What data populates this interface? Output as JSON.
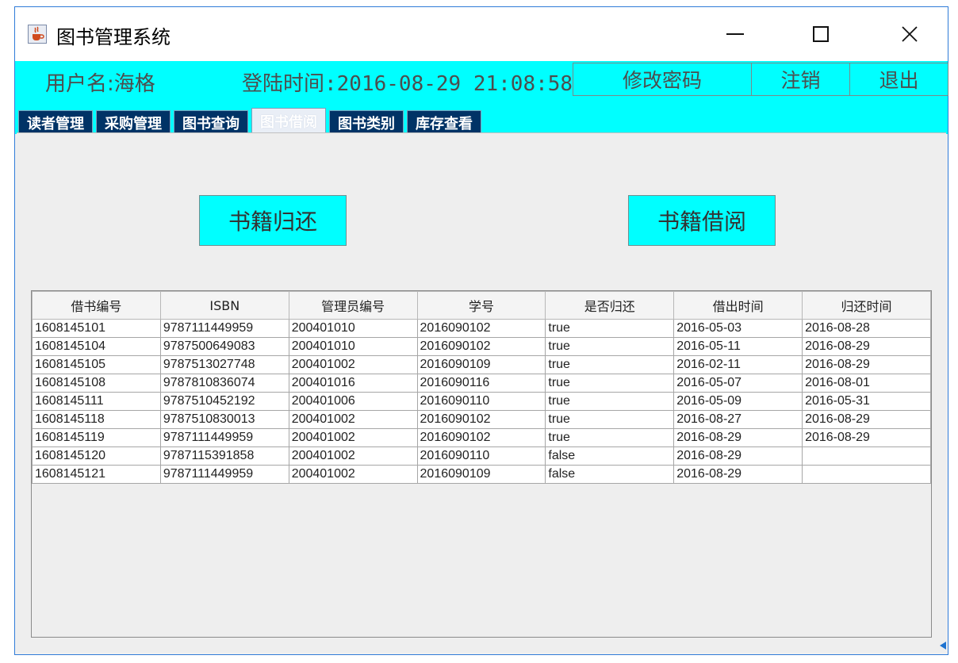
{
  "window": {
    "title": "图书管理系统",
    "icon": "java-cup-icon"
  },
  "header": {
    "username_label": "用户名:海格",
    "login_time_label": "登陆时间:2016-08-29 21:08:58",
    "actions": {
      "change_password": "修改密码",
      "logout": "注销",
      "exit": "退出"
    }
  },
  "tabs": [
    {
      "label": "读者管理"
    },
    {
      "label": "采购管理"
    },
    {
      "label": "图书查询"
    },
    {
      "label": "图书借阅"
    },
    {
      "label": "图书类别"
    },
    {
      "label": "库存查看"
    }
  ],
  "buttons": {
    "return_books": "书籍归还",
    "borrow_books": "书籍借阅"
  },
  "table": {
    "columns": [
      "借书编号",
      "ISBN",
      "管理员编号",
      "学号",
      "是否归还",
      "借出时间",
      "归还时间"
    ],
    "rows": [
      [
        "1608145101",
        "9787111449959",
        "200401010",
        "2016090102",
        "true",
        "2016-05-03",
        "2016-08-28"
      ],
      [
        "1608145104",
        "9787500649083",
        "200401010",
        "2016090102",
        "true",
        "2016-05-11",
        "2016-08-29"
      ],
      [
        "1608145105",
        "9787513027748",
        "200401002",
        "2016090109",
        "true",
        "2016-02-11",
        "2016-08-29"
      ],
      [
        "1608145108",
        "9787810836074",
        "200401016",
        "2016090116",
        "true",
        "2016-05-07",
        "2016-08-01"
      ],
      [
        "1608145111",
        "9787510452192",
        "200401006",
        "2016090110",
        "true",
        "2016-05-09",
        "2016-05-31"
      ],
      [
        "1608145118",
        "9787510830013",
        "200401002",
        "2016090102",
        "true",
        "2016-08-27",
        "2016-08-29"
      ],
      [
        "1608145119",
        "9787111449959",
        "200401002",
        "2016090102",
        "true",
        "2016-08-29",
        "2016-08-29"
      ],
      [
        "1608145120",
        "9787115391858",
        "200401002",
        "2016090110",
        "false",
        "2016-08-29",
        ""
      ],
      [
        "1608145121",
        "9787111449959",
        "200401002",
        "2016090109",
        "false",
        "2016-08-29",
        ""
      ]
    ]
  },
  "colors": {
    "accent": "#00ffff",
    "tab_background": "#003366",
    "window_border": "#2f7bd8"
  }
}
